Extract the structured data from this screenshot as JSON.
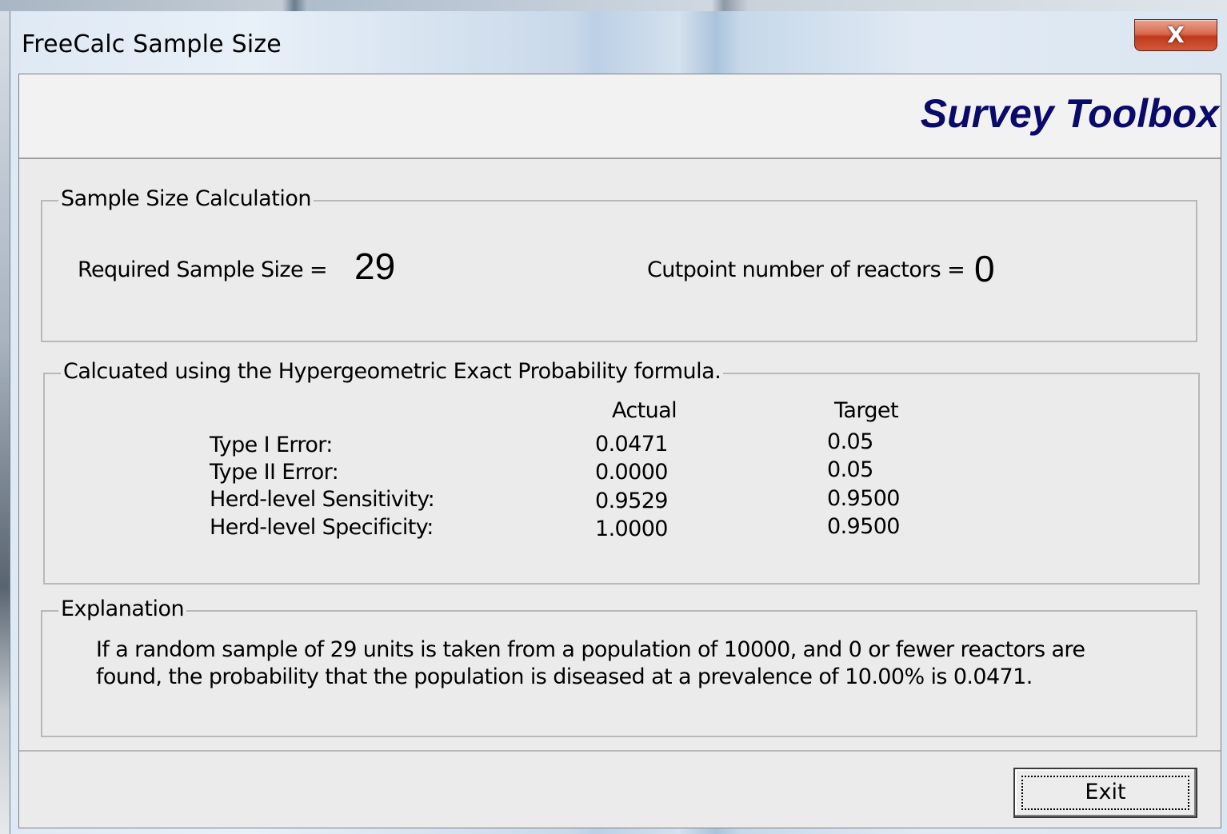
{
  "window": {
    "title": "FreeCalc Sample Size",
    "close_glyph": "X"
  },
  "header": {
    "brand": "Survey Toolbox"
  },
  "sample_size": {
    "group_title": "Sample Size Calculation",
    "required_label": "Required Sample Size =",
    "required_value": "29",
    "cutpoint_label": "Cutpoint number of reactors =",
    "cutpoint_value": "0"
  },
  "formula": {
    "group_title": "Calcuated using the Hypergeometric Exact Probability formula.",
    "col_actual": "Actual",
    "col_target": "Target",
    "rows": [
      {
        "label": "Type I Error:",
        "actual": "0.0471",
        "target": "0.05"
      },
      {
        "label": "Type II Error:",
        "actual": "0.0000",
        "target": "0.05"
      },
      {
        "label": "Herd-level Sensitivity:",
        "actual": "0.9529",
        "target": "0.9500"
      },
      {
        "label": "Herd-level Specificity:",
        "actual": "1.0000",
        "target": "0.9500"
      }
    ]
  },
  "explanation": {
    "group_title": "Explanation",
    "line1": "If a random sample of 29 units is taken from a population of 10000, and 0 or fewer reactors are",
    "line2": "found, the probability that the population is diseased at a prevalence of 10.00% is 0.0471."
  },
  "buttons": {
    "exit": "Exit"
  }
}
